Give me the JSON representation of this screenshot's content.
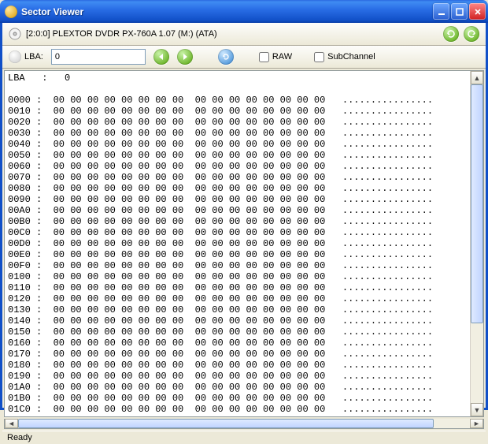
{
  "window": {
    "title": "Sector Viewer",
    "min_tip": "Minimize",
    "max_tip": "Maximize",
    "close_tip": "Close"
  },
  "toolbar": {
    "device": "[2:0:0] PLEXTOR DVDR   PX-760A 1.07 (M:) (ATA)",
    "refresh1_tip": "Refresh Forward",
    "refresh2_tip": "Refresh Back"
  },
  "toolbar2": {
    "lba_label": "LBA:",
    "lba_value": "0",
    "prev_tip": "Previous",
    "next_tip": "Next",
    "reload_tip": "Reload",
    "raw_label": "RAW",
    "raw_checked": false,
    "subch_label": "SubChannel",
    "subch_checked": false
  },
  "hex": {
    "header": "LBA   :   0",
    "offsets": [
      "0000",
      "0010",
      "0020",
      "0030",
      "0040",
      "0050",
      "0060",
      "0070",
      "0080",
      "0090",
      "00A0",
      "00B0",
      "00C0",
      "00D0",
      "00E0",
      "00F0",
      "0100",
      "0110",
      "0120",
      "0130",
      "0140",
      "0150",
      "0160",
      "0170",
      "0180",
      "0190",
      "01A0",
      "01B0",
      "01C0"
    ],
    "byte": "00",
    "ascii_char": ".",
    "bytes_per_row": 16
  },
  "status": {
    "text": "Ready"
  }
}
